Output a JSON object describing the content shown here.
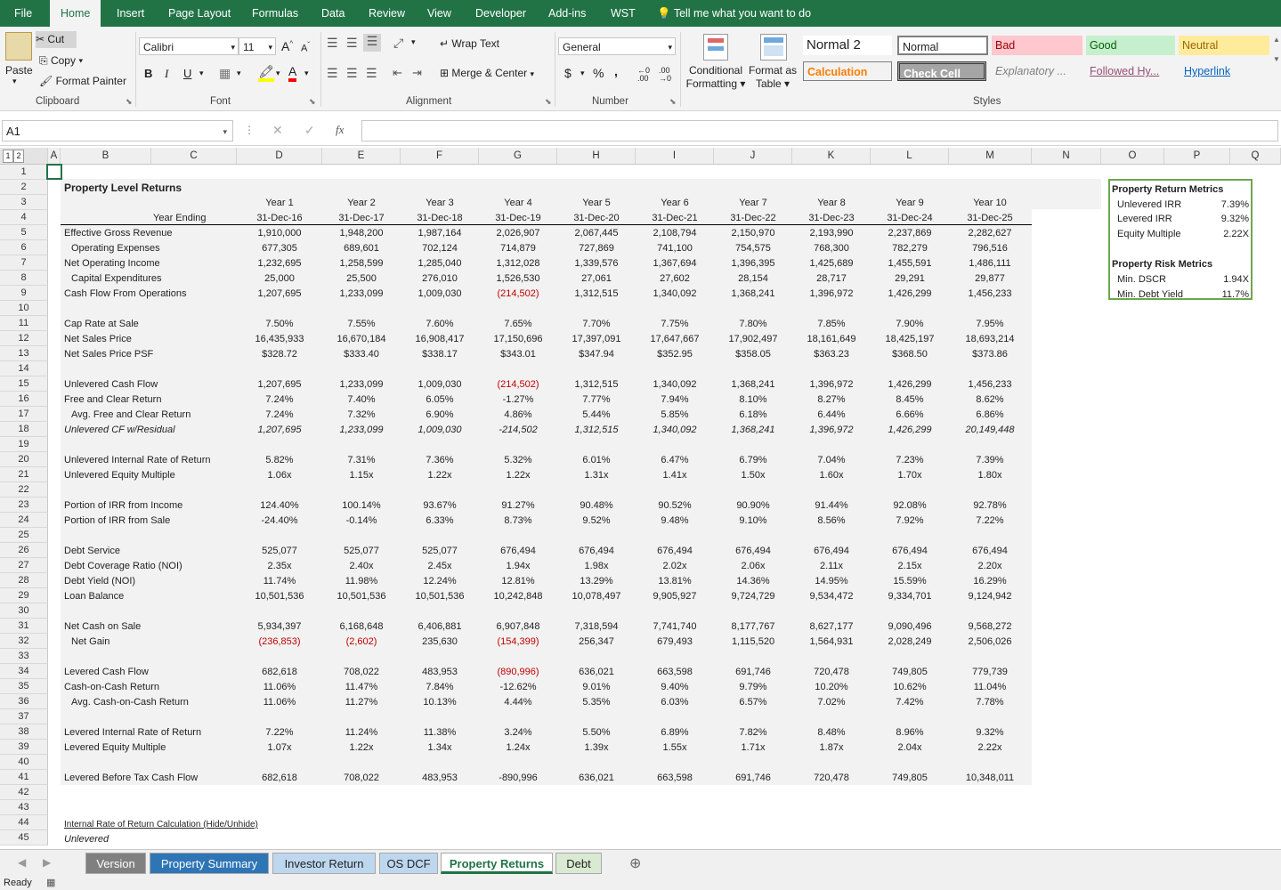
{
  "menu": [
    "File",
    "Home",
    "Insert",
    "Page Layout",
    "Formulas",
    "Data",
    "Review",
    "View",
    "Developer",
    "Add-ins",
    "WST"
  ],
  "tell_me": "Tell me what you want to do",
  "ribbon": {
    "clipboard": {
      "paste": "Paste",
      "cut": "Cut",
      "copy": "Copy",
      "format_painter": "Format Painter",
      "label": "Clipboard"
    },
    "font": {
      "name": "Calibri",
      "size": "11",
      "bold": "B",
      "italic": "I",
      "underline": "U",
      "label": "Font"
    },
    "alignment": {
      "wrap": "Wrap Text",
      "merge": "Merge & Center",
      "label": "Alignment"
    },
    "number": {
      "format": "General",
      "currency": "$",
      "percent": "%",
      "comma": ",",
      "label": "Number"
    },
    "cond_format": [
      "Conditional",
      "Formatting"
    ],
    "format_table": [
      "Format as",
      "Table"
    ],
    "styles": {
      "label": "Styles",
      "normal2": "Normal 2",
      "normal": "Normal",
      "bad": "Bad",
      "good": "Good",
      "neutral": "Neutral",
      "calculation": "Calculation",
      "check_cell": "Check Cell",
      "explanatory": "Explanatory ...",
      "followed": "Followed Hy...",
      "hyperlink": "Hyperlink"
    }
  },
  "formula_bar": {
    "name_box": "A1",
    "fx": "fx",
    "value": ""
  },
  "columns": [
    "A",
    "B",
    "C",
    "D",
    "E",
    "F",
    "G",
    "H",
    "I",
    "J",
    "K",
    "L",
    "M",
    "N",
    "O",
    "P",
    "Q"
  ],
  "outline_levels": [
    "1",
    "2"
  ],
  "sheet": {
    "title": "Property Level Returns",
    "year_ending": "Year Ending",
    "years": [
      "Year 1",
      "Year 2",
      "Year 3",
      "Year 4",
      "Year 5",
      "Year 6",
      "Year 7",
      "Year 8",
      "Year 9",
      "Year 10"
    ],
    "dates": [
      "31-Dec-16",
      "31-Dec-17",
      "31-Dec-18",
      "31-Dec-19",
      "31-Dec-20",
      "31-Dec-21",
      "31-Dec-22",
      "31-Dec-23",
      "31-Dec-24",
      "31-Dec-25"
    ],
    "rows": [
      {
        "r": 5,
        "label": "Effective Gross Revenue",
        "v": [
          "1,910,000",
          "1,948,200",
          "1,987,164",
          "2,026,907",
          "2,067,445",
          "2,108,794",
          "2,150,970",
          "2,193,990",
          "2,237,869",
          "2,282,627"
        ]
      },
      {
        "r": 6,
        "label": "Operating Expenses",
        "indent": 1,
        "v": [
          "677,305",
          "689,601",
          "702,124",
          "714,879",
          "727,869",
          "741,100",
          "754,575",
          "768,300",
          "782,279",
          "796,516"
        ]
      },
      {
        "r": 7,
        "label": "Net Operating Income",
        "v": [
          "1,232,695",
          "1,258,599",
          "1,285,040",
          "1,312,028",
          "1,339,576",
          "1,367,694",
          "1,396,395",
          "1,425,689",
          "1,455,591",
          "1,486,111"
        ]
      },
      {
        "r": 8,
        "label": "Capital Expenditures",
        "indent": 1,
        "v": [
          "25,000",
          "25,500",
          "276,010",
          "1,526,530",
          "27,061",
          "27,602",
          "28,154",
          "28,717",
          "29,291",
          "29,877"
        ]
      },
      {
        "r": 9,
        "label": "Cash Flow From Operations",
        "v": [
          "1,207,695",
          "1,233,099",
          "1,009,030",
          "(214,502)",
          "1,312,515",
          "1,340,092",
          "1,368,241",
          "1,396,972",
          "1,426,299",
          "1,456,233"
        ]
      },
      {
        "r": 11,
        "label": "Cap Rate at Sale",
        "v": [
          "7.50%",
          "7.55%",
          "7.60%",
          "7.65%",
          "7.70%",
          "7.75%",
          "7.80%",
          "7.85%",
          "7.90%",
          "7.95%"
        ]
      },
      {
        "r": 12,
        "label": "Net Sales Price",
        "v": [
          "16,435,933",
          "16,670,184",
          "16,908,417",
          "17,150,696",
          "17,397,091",
          "17,647,667",
          "17,902,497",
          "18,161,649",
          "18,425,197",
          "18,693,214"
        ]
      },
      {
        "r": 13,
        "label": "Net Sales Price PSF",
        "v": [
          "$328.72",
          "$333.40",
          "$338.17",
          "$343.01",
          "$347.94",
          "$352.95",
          "$358.05",
          "$363.23",
          "$368.50",
          "$373.86"
        ]
      },
      {
        "r": 15,
        "label": "Unlevered Cash Flow",
        "v": [
          "1,207,695",
          "1,233,099",
          "1,009,030",
          "(214,502)",
          "1,312,515",
          "1,340,092",
          "1,368,241",
          "1,396,972",
          "1,426,299",
          "1,456,233"
        ]
      },
      {
        "r": 16,
        "label": "Free and Clear Return",
        "v": [
          "7.24%",
          "7.40%",
          "6.05%",
          "-1.27%",
          "7.77%",
          "7.94%",
          "8.10%",
          "8.27%",
          "8.45%",
          "8.62%"
        ]
      },
      {
        "r": 17,
        "label": "Avg. Free and Clear Return",
        "indent": 1,
        "v": [
          "7.24%",
          "7.32%",
          "6.90%",
          "4.86%",
          "5.44%",
          "5.85%",
          "6.18%",
          "6.44%",
          "6.66%",
          "6.86%"
        ]
      },
      {
        "r": 18,
        "label": "Unlevered CF w/Residual",
        "italic": true,
        "v": [
          "1,207,695",
          "1,233,099",
          "1,009,030",
          "-214,502",
          "1,312,515",
          "1,340,092",
          "1,368,241",
          "1,396,972",
          "1,426,299",
          "20,149,448"
        ]
      },
      {
        "r": 20,
        "label": "Unlevered Internal Rate of Return",
        "v": [
          "5.82%",
          "7.31%",
          "7.36%",
          "5.32%",
          "6.01%",
          "6.47%",
          "6.79%",
          "7.04%",
          "7.23%",
          "7.39%"
        ]
      },
      {
        "r": 21,
        "label": "Unlevered Equity Multiple",
        "v": [
          "1.06x",
          "1.15x",
          "1.22x",
          "1.22x",
          "1.31x",
          "1.41x",
          "1.50x",
          "1.60x",
          "1.70x",
          "1.80x"
        ]
      },
      {
        "r": 23,
        "label": "Portion of IRR from Income",
        "v": [
          "124.40%",
          "100.14%",
          "93.67%",
          "91.27%",
          "90.48%",
          "90.52%",
          "90.90%",
          "91.44%",
          "92.08%",
          "92.78%"
        ]
      },
      {
        "r": 24,
        "label": "Portion of IRR from Sale",
        "v": [
          "-24.40%",
          "-0.14%",
          "6.33%",
          "8.73%",
          "9.52%",
          "9.48%",
          "9.10%",
          "8.56%",
          "7.92%",
          "7.22%"
        ]
      },
      {
        "r": 26,
        "label": "Debt Service",
        "v": [
          "525,077",
          "525,077",
          "525,077",
          "676,494",
          "676,494",
          "676,494",
          "676,494",
          "676,494",
          "676,494",
          "676,494"
        ]
      },
      {
        "r": 27,
        "label": "Debt Coverage Ratio (NOI)",
        "v": [
          "2.35x",
          "2.40x",
          "2.45x",
          "1.94x",
          "1.98x",
          "2.02x",
          "2.06x",
          "2.11x",
          "2.15x",
          "2.20x"
        ]
      },
      {
        "r": 28,
        "label": "Debt Yield (NOI)",
        "v": [
          "11.74%",
          "11.98%",
          "12.24%",
          "12.81%",
          "13.29%",
          "13.81%",
          "14.36%",
          "14.95%",
          "15.59%",
          "16.29%"
        ]
      },
      {
        "r": 29,
        "label": "Loan Balance",
        "v": [
          "10,501,536",
          "10,501,536",
          "10,501,536",
          "10,242,848",
          "10,078,497",
          "9,905,927",
          "9,724,729",
          "9,534,472",
          "9,334,701",
          "9,124,942"
        ]
      },
      {
        "r": 31,
        "label": "Net Cash on Sale",
        "v": [
          "5,934,397",
          "6,168,648",
          "6,406,881",
          "6,907,848",
          "7,318,594",
          "7,741,740",
          "8,177,767",
          "8,627,177",
          "9,090,496",
          "9,568,272"
        ]
      },
      {
        "r": 32,
        "label": "Net Gain",
        "indent": 1,
        "v": [
          "(236,853)",
          "(2,602)",
          "235,630",
          "(154,399)",
          "256,347",
          "679,493",
          "1,115,520",
          "1,564,931",
          "2,028,249",
          "2,506,026"
        ]
      },
      {
        "r": 34,
        "label": "Levered Cash Flow",
        "v": [
          "682,618",
          "708,022",
          "483,953",
          "(890,996)",
          "636,021",
          "663,598",
          "691,746",
          "720,478",
          "749,805",
          "779,739"
        ]
      },
      {
        "r": 35,
        "label": "Cash-on-Cash Return",
        "v": [
          "11.06%",
          "11.47%",
          "7.84%",
          "-12.62%",
          "9.01%",
          "9.40%",
          "9.79%",
          "10.20%",
          "10.62%",
          "11.04%"
        ]
      },
      {
        "r": 36,
        "label": "Avg. Cash-on-Cash Return",
        "indent": 1,
        "v": [
          "11.06%",
          "11.27%",
          "10.13%",
          "4.44%",
          "5.35%",
          "6.03%",
          "6.57%",
          "7.02%",
          "7.42%",
          "7.78%"
        ]
      },
      {
        "r": 38,
        "label": "Levered Internal Rate of Return",
        "v": [
          "7.22%",
          "11.24%",
          "11.38%",
          "3.24%",
          "5.50%",
          "6.89%",
          "7.82%",
          "8.48%",
          "8.96%",
          "9.32%"
        ]
      },
      {
        "r": 39,
        "label": "Levered Equity Multiple",
        "v": [
          "1.07x",
          "1.22x",
          "1.34x",
          "1.24x",
          "1.39x",
          "1.55x",
          "1.71x",
          "1.87x",
          "2.04x",
          "2.22x"
        ]
      },
      {
        "r": 41,
        "label": "Levered Before Tax Cash Flow",
        "v": [
          "682,618",
          "708,022",
          "483,953",
          "-890,996",
          "636,021",
          "663,598",
          "691,746",
          "720,478",
          "749,805",
          "10,348,011"
        ]
      }
    ],
    "row44": "Internal Rate of Return Calculation (Hide/Unhide)",
    "row45": "Unlevered"
  },
  "metrics": {
    "return_title": "Property Return Metrics",
    "return_items": [
      {
        "label": "Unlevered IRR",
        "value": "7.39%"
      },
      {
        "label": "Levered IRR",
        "value": "9.32%"
      },
      {
        "label": "Equity Multiple",
        "value": "2.22X"
      }
    ],
    "risk_title": "Property Risk Metrics",
    "risk_items": [
      {
        "label": "Min. DSCR",
        "value": "1.94X"
      },
      {
        "label": "Min. Debt Yield",
        "value": "11.7%"
      }
    ]
  },
  "sheet_tabs": [
    "Version",
    "Property Summary",
    "Investor Return",
    "OS DCF",
    "Property Returns",
    "Debt"
  ],
  "active_tab": "Property Returns",
  "status": "Ready",
  "colors": {
    "excel_green": "#217346",
    "tab_version": "#808080",
    "tab_summary": "#2e75b6",
    "tab_investor": "#bdd7ee",
    "tab_debt": "#d9ead3",
    "metrics_border": "#6aa84f",
    "negative": "#c00000"
  }
}
